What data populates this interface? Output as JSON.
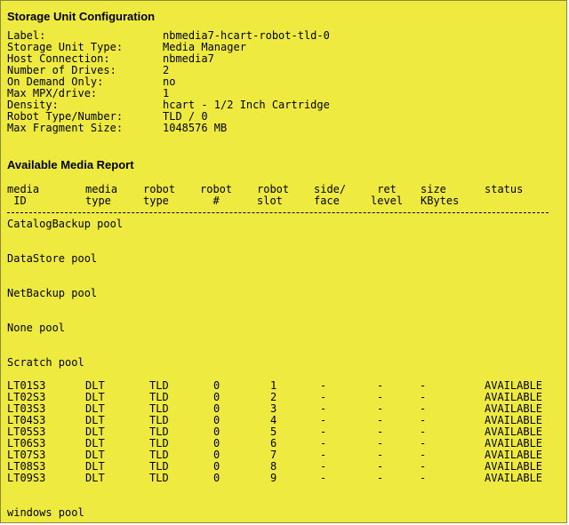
{
  "config": {
    "title": "Storage Unit Configuration",
    "fields": [
      {
        "label": "Label:",
        "value": "nbmedia7-hcart-robot-tld-0"
      },
      {
        "label": "Storage Unit Type:",
        "value": "Media Manager"
      },
      {
        "label": "Host Connection:",
        "value": "nbmedia7"
      },
      {
        "label": "Number of Drives:",
        "value": "2"
      },
      {
        "label": "On Demand Only:",
        "value": "no"
      },
      {
        "label": "Max MPX/drive:",
        "value": "1"
      },
      {
        "label": "Density:",
        "value": "hcart - 1/2 Inch Cartridge"
      },
      {
        "label": "Robot Type/Number:",
        "value": "TLD / 0"
      },
      {
        "label": "Max Fragment Size:",
        "value": "1048576 MB"
      }
    ]
  },
  "report": {
    "title": "Available Media Report",
    "columns": [
      {
        "line1": "media",
        "line2": " ID"
      },
      {
        "line1": "media",
        "line2": "type"
      },
      {
        "line1": "robot",
        "line2": "type"
      },
      {
        "line1": "robot",
        "line2": "  #"
      },
      {
        "line1": "robot",
        "line2": "slot"
      },
      {
        "line1": "side/",
        "line2": "face"
      },
      {
        "line1": " ret",
        "line2": "level"
      },
      {
        "line1": "size",
        "line2": "KBytes"
      },
      {
        "line1": "status",
        "line2": ""
      }
    ],
    "pools": [
      {
        "name": "CatalogBackup pool",
        "rows": []
      },
      {
        "name": "DataStore pool",
        "rows": []
      },
      {
        "name": "NetBackup pool",
        "rows": []
      },
      {
        "name": "None pool",
        "rows": []
      },
      {
        "name": "Scratch pool",
        "rows": [
          [
            "LT01S3",
            "DLT",
            "TLD",
            "0",
            "1",
            "-",
            "-",
            "-",
            "AVAILABLE"
          ],
          [
            "LT02S3",
            "DLT",
            "TLD",
            "0",
            "2",
            "-",
            "-",
            "-",
            "AVAILABLE"
          ],
          [
            "LT03S3",
            "DLT",
            "TLD",
            "0",
            "3",
            "-",
            "-",
            "-",
            "AVAILABLE"
          ],
          [
            "LT04S3",
            "DLT",
            "TLD",
            "0",
            "4",
            "-",
            "-",
            "-",
            "AVAILABLE"
          ],
          [
            "LT05S3",
            "DLT",
            "TLD",
            "0",
            "5",
            "-",
            "-",
            "-",
            "AVAILABLE"
          ],
          [
            "LT06S3",
            "DLT",
            "TLD",
            "0",
            "6",
            "-",
            "-",
            "-",
            "AVAILABLE"
          ],
          [
            "LT07S3",
            "DLT",
            "TLD",
            "0",
            "7",
            "-",
            "-",
            "-",
            "AVAILABLE"
          ],
          [
            "LT08S3",
            "DLT",
            "TLD",
            "0",
            "8",
            "-",
            "-",
            "-",
            "AVAILABLE"
          ],
          [
            "LT09S3",
            "DLT",
            "TLD",
            "0",
            "9",
            "-",
            "-",
            "-",
            "AVAILABLE"
          ]
        ]
      },
      {
        "name": "windows pool",
        "rows": []
      }
    ]
  }
}
